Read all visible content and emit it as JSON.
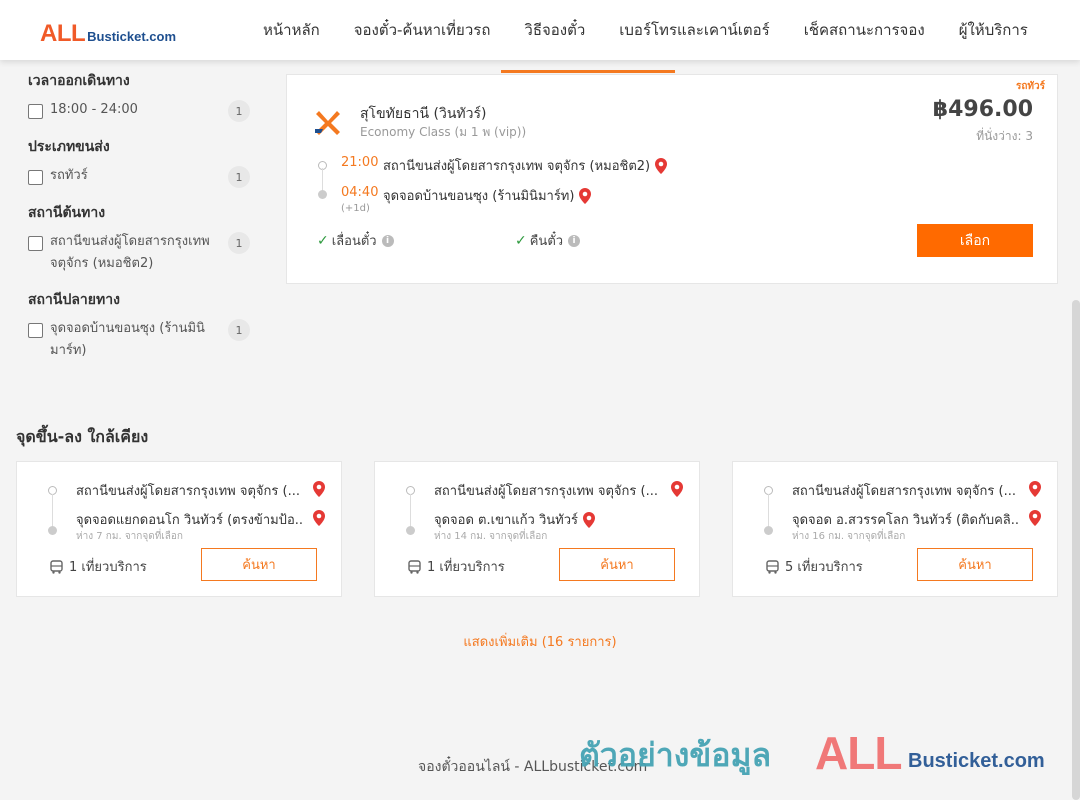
{
  "header": {
    "logo_all": "ALL",
    "logo_rest": "Busticket.com",
    "nav": [
      {
        "label": "หน้าหลัก"
      },
      {
        "label": "จองตั๋ว-ค้นหาเที่ยวรถ"
      },
      {
        "label": "วิธีจองตั๋ว"
      },
      {
        "label": "เบอร์โทรและเคาน์เตอร์"
      },
      {
        "label": "เช็คสถานะการจอง"
      },
      {
        "label": "ผู้ให้บริการ"
      }
    ]
  },
  "filters": {
    "departure_time": {
      "title": "เวลาออกเดินทาง",
      "option": "18:00 - 24:00",
      "count": "1"
    },
    "transport_type": {
      "title": "ประเภทขนส่ง",
      "option": "รถทัวร์",
      "count": "1"
    },
    "origin": {
      "title": "สถานีต้นทาง",
      "option": "สถานีขนส่งผู้โดยสารกรุงเทพ จตุจักร (หมอชิต2)",
      "count": "1"
    },
    "destination": {
      "title": "สถานีปลายทาง",
      "option": "จุดจอดบ้านขอนซุง (ร้านมินิมาร์ท)",
      "count": "1"
    }
  },
  "trip": {
    "tag": "รถทัวร์",
    "operator": "สุโขทัยธานี (วินทัวร์)",
    "bus_class": "Economy Class (ม 1 พ (vip))",
    "price": "฿496.00",
    "seats": "ที่นั่งว่าง: 3",
    "depart_time": "21:00",
    "depart_stop": "สถานีขนส่งผู้โดยสารกรุงเทพ จตุจักร (หมอชิต2)",
    "arrive_time": "04:40",
    "arrive_stop": "จุดจอดบ้านขอนซุง (ร้านมินิมาร์ท)",
    "plus_day": "(+1d)",
    "policy_change": "เลื่อนตั๋ว",
    "policy_refund": "คืนตั๋ว",
    "select_label": "เลือก"
  },
  "nearby": {
    "title": "จุดขึ้น-ลง ใกล้เคียง",
    "cards": [
      {
        "from": "สถานีขนส่งผู้โดยสารกรุงเทพ จตุจักร (...",
        "to": "จุดจอดแยกดอนโก วินทัวร์ (ตรงข้ามป้อ...",
        "distance": "ห่าง 7 กม. จากจุดที่เลือก",
        "trips": "1 เที่ยวบริการ",
        "search_label": "ค้นหา"
      },
      {
        "from": "สถานีขนส่งผู้โดยสารกรุงเทพ จตุจักร (...",
        "to": "จุดจอด ต.เขาแก้ว วินทัวร์",
        "distance": "ห่าง 14 กม. จากจุดที่เลือก",
        "trips": "1 เที่ยวบริการ",
        "search_label": "ค้นหา"
      },
      {
        "from": "สถานีขนส่งผู้โดยสารกรุงเทพ จตุจักร (...",
        "to": "จุดจอด อ.สวรรคโลก วินทัวร์ (ติดกับคลิ...",
        "distance": "ห่าง 16 กม. จากจุดที่เลือก",
        "trips": "5 เที่ยวบริการ",
        "search_label": "ค้นหา"
      }
    ],
    "show_more": "แสดงเพิ่มเติม (16 รายการ)"
  },
  "footer": {
    "text": "จองตั๋วออนไลน์ - ALLbusticket.com",
    "watermark_th": "ตัวอย่างข้อมูล",
    "watermark_all": "ALL",
    "watermark_rest": "Busticket.com"
  },
  "colors": {
    "accent": "#f47920",
    "button": "#ff6a00",
    "check": "#2e9a3e",
    "pin": "#e53935"
  }
}
